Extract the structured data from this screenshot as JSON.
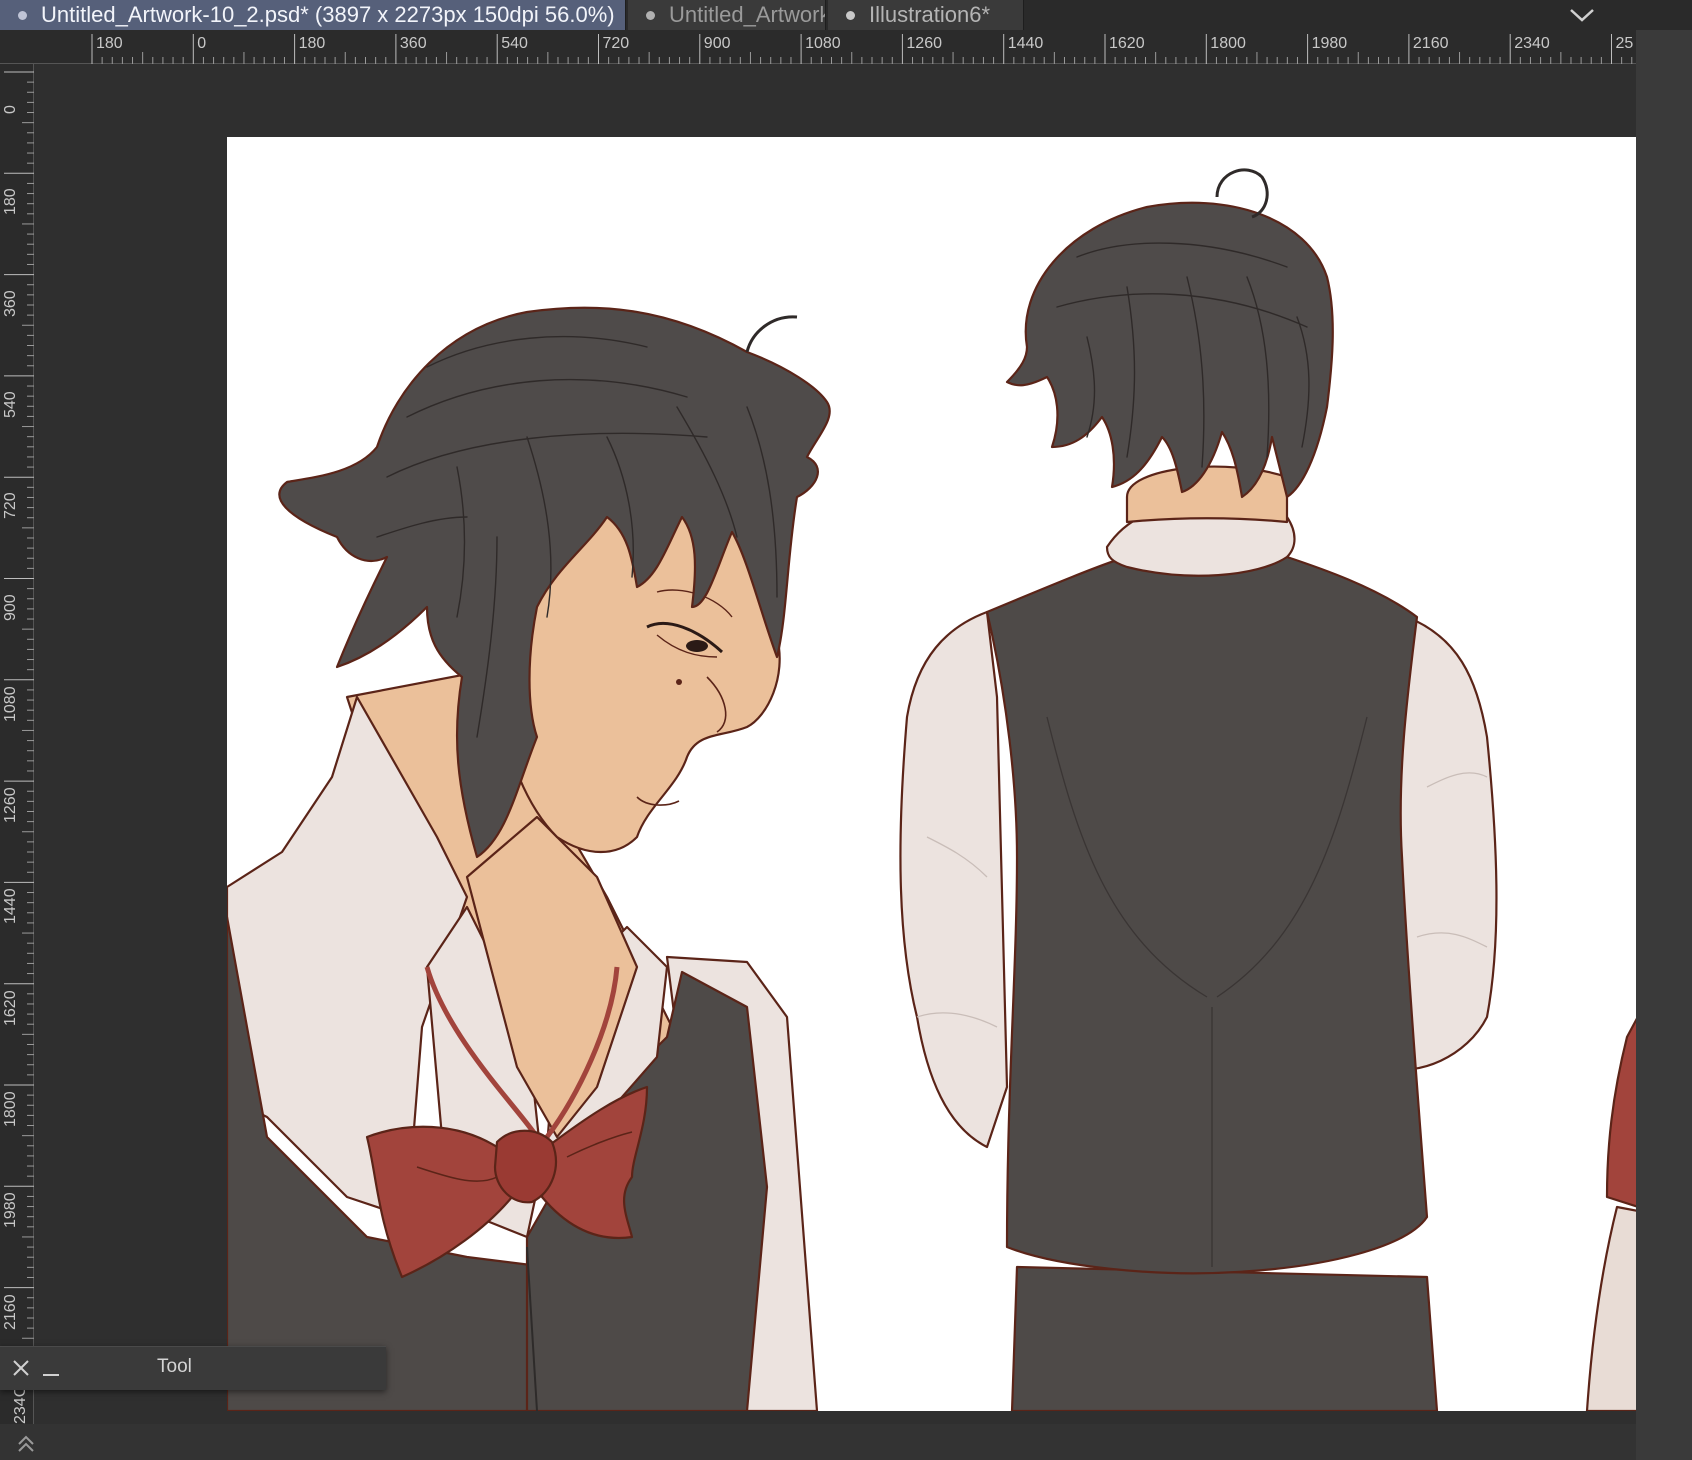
{
  "tabs": [
    {
      "label": "Untitled_Artwork-10_2.psd* (3897 x 2273px 150dpi 56.0%)",
      "active": true
    },
    {
      "label": "Untitled_Artwork",
      "active": false
    },
    {
      "label": "Illustration6*",
      "active": false
    }
  ],
  "ruler": {
    "horizontal_labels": [
      "180",
      "0",
      "180",
      "360",
      "540",
      "720",
      "900",
      "1080",
      "1260",
      "1440",
      "1620",
      "1800",
      "1980",
      "2160",
      "2340",
      "25"
    ],
    "vertical_labels": [
      "0",
      "180",
      "360",
      "540",
      "720",
      "900",
      "1080",
      "1260",
      "1440",
      "1620",
      "1800",
      "1980",
      "2160",
      "234C"
    ]
  },
  "tool_panel": {
    "title": "Tool"
  },
  "icons": {
    "dropdown": "chevron-down-icon",
    "close": "close-icon",
    "minimize": "minimize-icon",
    "expand": "double-chevron-up-icon"
  },
  "colors": {
    "active_tab": "#56607a",
    "workspace": "#2f2f2f",
    "canvas": "#ffffff",
    "hair": "#4f4b4a",
    "skin": "#ebc09a",
    "shirt": "#ece3df",
    "vest": "#4e4a48",
    "bow": "#a2443c",
    "outline": "#5b2418"
  }
}
